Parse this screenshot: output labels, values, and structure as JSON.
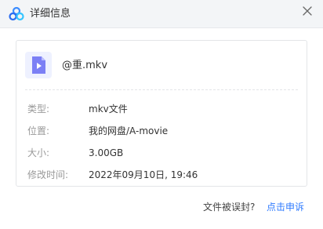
{
  "window": {
    "title": "详细信息",
    "close_icon": "close-icon",
    "logo_icon": "baidu-netdisk-logo-icon"
  },
  "file": {
    "name": "@重.mkv",
    "icon": "video-file-icon",
    "icon_color": "#7b7ff5"
  },
  "details": [
    {
      "label": "类型:",
      "value": "mkv文件"
    },
    {
      "label": "位置:",
      "value": "我的网盘/A-movie"
    },
    {
      "label": "大小:",
      "value": "3.00GB"
    },
    {
      "label": "修改时间:",
      "value": "2022年09月10日, 19:46"
    }
  ],
  "footer": {
    "question": "文件被误封?",
    "link": "点击申诉"
  },
  "colors": {
    "accent": "#2f7bff",
    "label": "#999999",
    "text": "#333333"
  }
}
